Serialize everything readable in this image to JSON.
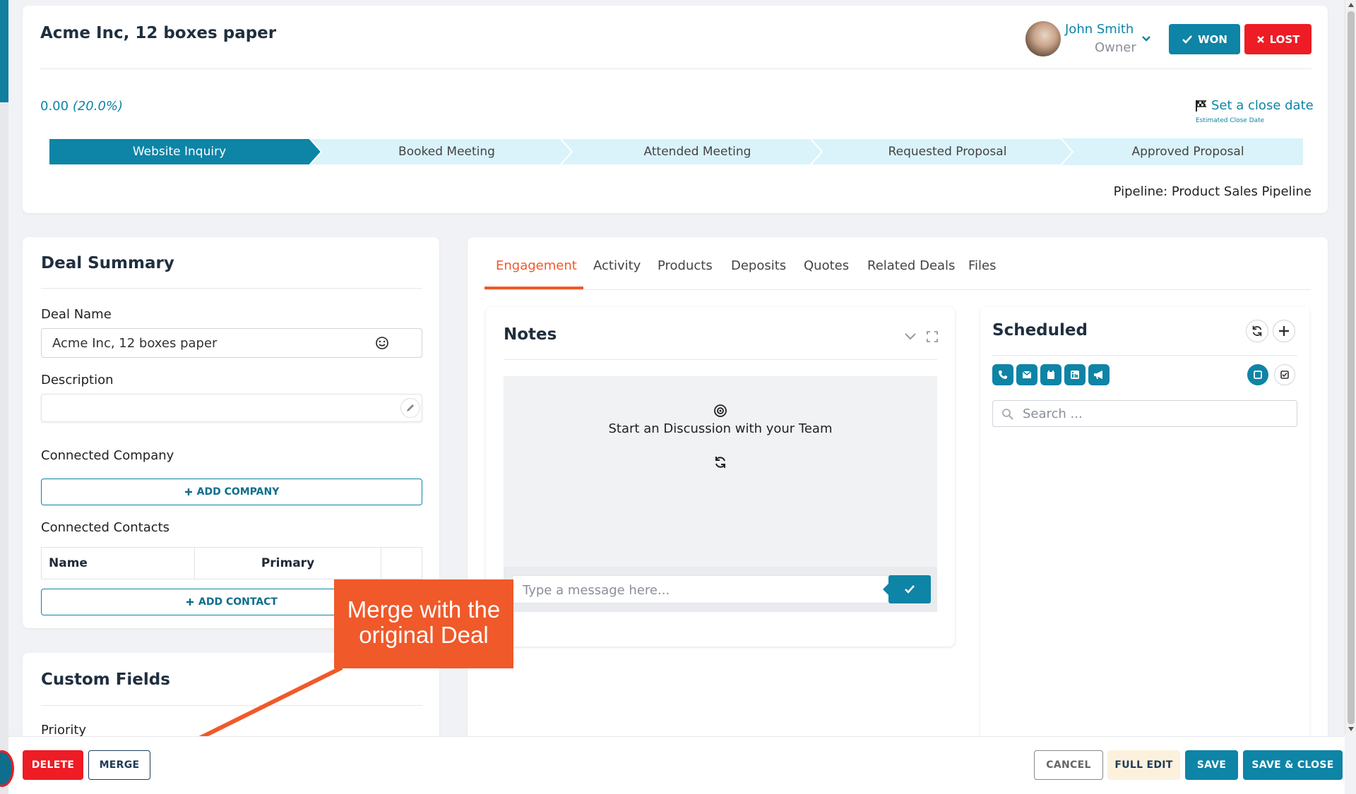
{
  "deal": {
    "title": "Acme Inc, 12 boxes paper",
    "amount": "0.00",
    "probability": "(20.0%)",
    "close_date_link": "Set a close date",
    "close_date_caption": "Estimated Close Date",
    "pipeline": "Pipeline: Product Sales Pipeline"
  },
  "owner": {
    "name": "John Smith",
    "role": "Owner"
  },
  "actions": {
    "won": "WON",
    "lost": "LOST"
  },
  "stages": [
    "Website Inquiry",
    "Booked Meeting",
    "Attended Meeting",
    "Requested Proposal",
    "Approved Proposal"
  ],
  "active_stage_index": 0,
  "summary": {
    "heading": "Deal Summary",
    "deal_name_label": "Deal Name",
    "deal_name_value": "Acme Inc, 12 boxes paper",
    "description_label": "Description",
    "description_value": "",
    "company_label": "Connected Company",
    "add_company": "ADD COMPANY",
    "contacts_label": "Connected Contacts",
    "contacts_columns": [
      "Name",
      "Primary",
      ""
    ],
    "add_contact": "ADD CONTACT"
  },
  "custom_fields": {
    "heading": "Custom Fields",
    "priority_label": "Priority"
  },
  "tabs": [
    "Engagement",
    "Activity",
    "Products",
    "Deposits",
    "Quotes",
    "Related Deals",
    "Files"
  ],
  "active_tab_index": 0,
  "notes": {
    "heading": "Notes",
    "empty_text": "Start an Discussion with your Team",
    "message_placeholder": "Type a message here..."
  },
  "scheduled": {
    "heading": "Scheduled",
    "search_placeholder": "Search ..."
  },
  "callout": {
    "text_line1": "Merge with the",
    "text_line2": "original Deal"
  },
  "footer": {
    "delete": "DELETE",
    "merge": "MERGE",
    "cancel": "CANCEL",
    "full_edit": "FULL EDIT",
    "save": "SAVE",
    "save_close": "SAVE & CLOSE"
  },
  "colors": {
    "teal": "#0e84a6",
    "red": "#ee1c24",
    "orange": "#f0592a",
    "stage_inactive": "#daf3fb",
    "full_edit_bg": "#fbf1dd"
  },
  "icons": [
    "chevron-down-icon",
    "check-icon",
    "x-icon",
    "flag-icon",
    "smiley-icon",
    "pencil-icon",
    "plus-icon",
    "target-icon",
    "refresh-icon",
    "expand-icon",
    "phone-icon",
    "mail-icon",
    "calendar-icon",
    "linkedin-icon",
    "megaphone-icon",
    "square-icon",
    "checkbox-icon",
    "search-icon",
    "send-icon"
  ]
}
